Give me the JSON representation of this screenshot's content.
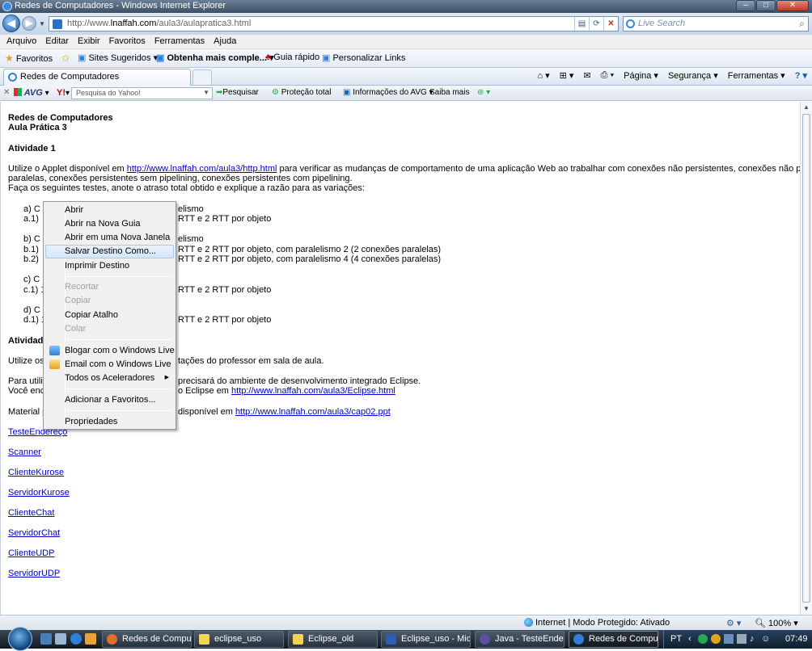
{
  "window": {
    "title": "Redes de Computadores - Windows Internet Explorer"
  },
  "address": {
    "url_prefix": "http://www.",
    "url_domain": "lnaffah.com",
    "url_path": "/aula3/aulapratica3.html",
    "search_placeholder": "Live Search"
  },
  "menu": [
    "Arquivo",
    "Editar",
    "Exibir",
    "Favoritos",
    "Ferramentas",
    "Ajuda"
  ],
  "favorites_bar": {
    "favorites": "Favoritos",
    "suggested": "Sites Sugeridos ▾",
    "more": "Obtenha mais comple... ▾",
    "quick": "Guia rápido",
    "customize": "Personalizar Links"
  },
  "tab": {
    "title": "Redes de Computadores"
  },
  "commands": [
    "Página ▾",
    "Segurança ▾",
    "Ferramentas ▾"
  ],
  "avg_bar": {
    "brand": "AVG",
    "yahoo": "Y!",
    "search_placeholder": "Pesquisa do Yahoo!",
    "search_btn": "Pesquisar",
    "protection": "Proteção total",
    "info": "Informações do AVG",
    "more": "Saiba mais"
  },
  "content": {
    "heading1": "Redes de Computadores",
    "heading2": "Aula Prática 3",
    "activity1": "Atividade 1",
    "intro_pre": "Utilize o Applet disponível em ",
    "intro_link": "http://www.lnaffah.com/aula3/http.html",
    "intro_post": " para verificar as mudanças de comportamento de uma aplicação Web ao trabalhar com conexões não persistentes, conexões não persistentes",
    "intro_line2": "paralelas, conexões persistentes sem pipelining, conexões persistentes com pipelining.",
    "intro_line3": "Faça os seguintes testes, anote o atraso total obtido e explique a razão para as variações:",
    "a": "a)   C",
    "a_tail": "elismo",
    "a1": "a.1)",
    "a1_tail": "RTT e 2 RTT por objeto",
    "b": "b)   C",
    "b_tail": "elismo",
    "b1": "b.1)",
    "b1_tail": "RTT e 2 RTT por objeto, com paralelismo 2 (2 conexões paralelas)",
    "b2": "b.2)",
    "b2_tail": "RTT e 2 RTT por objeto, com paralelismo 4 (4 conexões paralelas)",
    "c": "c)   C",
    "c1": "c.1) 1",
    "c1_tail": "RTT e 2 RTT por objeto",
    "d": "d)   C",
    "d1": "d.1) 1",
    "d1_tail": "RTT e 2 RTT por objeto",
    "activity2": "Atividade",
    "use_pre": "Utilize os",
    "use_tail": "tações do professor em sala de aula.",
    "para_pre": "Para utiliz",
    "para_tail": "precisará do ambiente de desenvolvimento integrado Eclipse.",
    "voce_pre": "Você enc",
    "voce_tail": "o Eclipse em ",
    "eclipse_link": "http://www.lnaffah.com/aula3/Eclipse.html",
    "mat_pre": "Material p",
    "mat_tail": "disponível em ",
    "cap_link": "http://www.lnaffah.com/aula3/cap02.ppt",
    "links": [
      "TesteEndereço",
      "Scanner",
      "ClienteKurose",
      "ServidorKurose",
      "ClienteChat",
      "ServidorChat",
      "ClienteUDP",
      "ServidorUDP"
    ]
  },
  "context_menu": {
    "abrir": "Abrir",
    "nova_guia": "Abrir na Nova Guia",
    "nova_janela": "Abrir em uma Nova Janela",
    "salvar": "Salvar Destino Como...",
    "imprimir": "Imprimir Destino",
    "recortar": "Recortar",
    "copiar": "Copiar",
    "copiar_atalho": "Copiar Atalho",
    "colar": "Colar",
    "blogar": "Blogar com o Windows Live",
    "email": "Email com o Windows Live",
    "aceleradores": "Todos os Aceleradores",
    "adicionar": "Adicionar a Favoritos...",
    "propriedades": "Propriedades"
  },
  "status": {
    "zone": "Internet | Modo Protegido: Ativado",
    "zoom": "100%"
  },
  "taskbar": {
    "items": [
      "Redes de Comput...",
      "eclipse_uso",
      "Eclipse_old",
      "Eclipse_uso - Micr...",
      "Java - TesteEnder...",
      "Redes de Comput..."
    ],
    "lang": "PT",
    "clock": "07:49"
  }
}
